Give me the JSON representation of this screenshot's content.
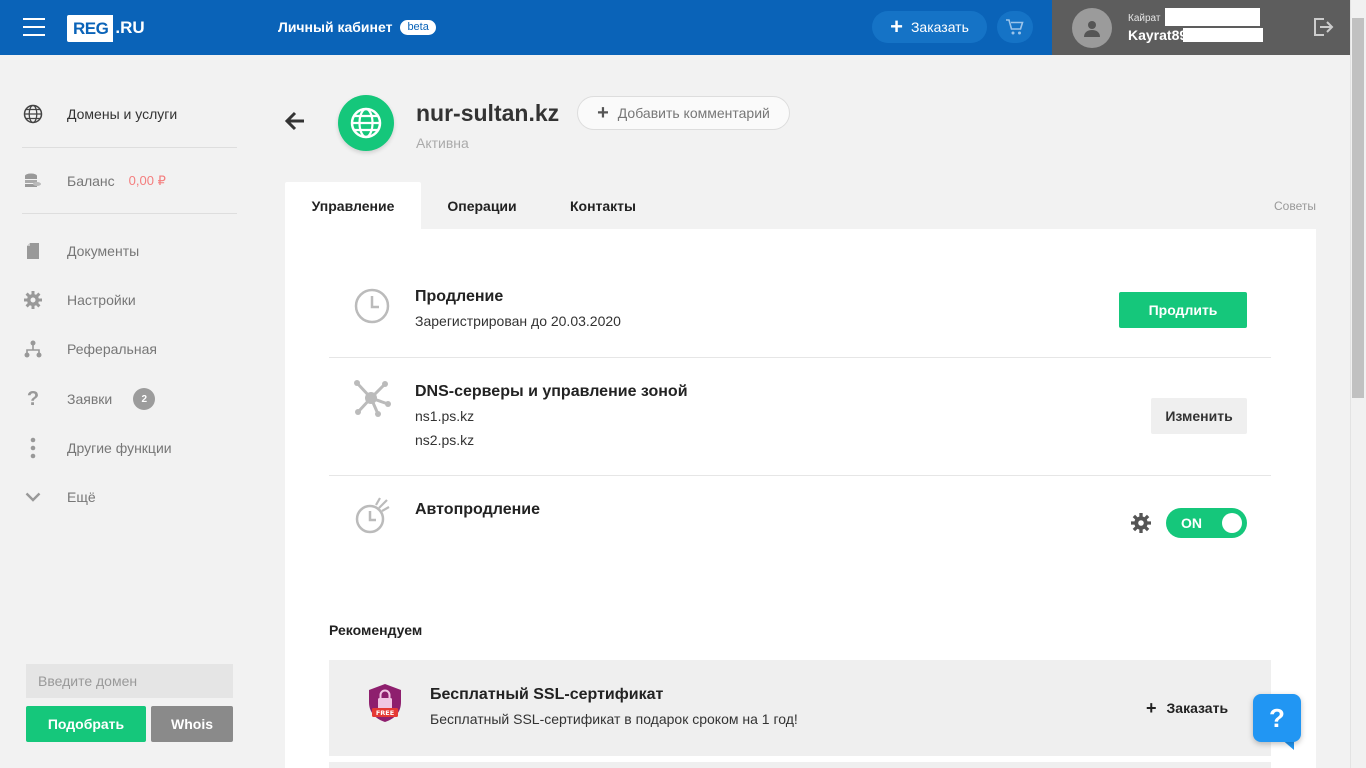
{
  "header": {
    "logo_reg": "REG",
    "logo_ru": ".RU",
    "cabinet_title": "Личный кабинет",
    "beta_badge": "beta",
    "order_label": "Заказать",
    "user_label": "Кайрат",
    "user_login": "Kayrat89"
  },
  "sidebar": {
    "items": [
      {
        "label": "Домены и услуги",
        "icon": "globe-icon"
      },
      {
        "label": "Баланс",
        "value": "0,00 ₽",
        "icon": "coins-icon"
      },
      {
        "label": "Документы",
        "icon": "document-icon"
      },
      {
        "label": "Настройки",
        "icon": "gear-icon"
      },
      {
        "label": "Реферальная",
        "icon": "referral-icon"
      },
      {
        "label": "Заявки",
        "badge": "2",
        "icon": "question-icon"
      },
      {
        "label": "Другие функции",
        "icon": "more-icon"
      },
      {
        "label": "Ещё",
        "icon": "chevron-down-icon"
      }
    ],
    "domain_placeholder": "Введите домен",
    "pick_label": "Подобрать",
    "whois_label": "Whois"
  },
  "domain": {
    "name": "nur-sultan.kz",
    "status": "Активна",
    "comment_label": "Добавить комментарий"
  },
  "tabs": [
    {
      "label": "Управление",
      "active": true
    },
    {
      "label": "Операции",
      "active": false
    },
    {
      "label": "Контакты",
      "active": false
    }
  ],
  "tips_label": "Советы",
  "rows": {
    "renewal": {
      "title": "Продление",
      "text": "Зарегистрирован до 20.03.2020",
      "button": "Продлить"
    },
    "dns": {
      "title": "DNS-серверы и управление зоной",
      "ns1": "ns1.ps.kz",
      "ns2": "ns2.ps.kz",
      "button": "Изменить"
    },
    "autorenew": {
      "title": "Автопродление",
      "toggle": "ON"
    }
  },
  "recommend": {
    "heading": "Рекомендуем",
    "title": "Бесплатный SSL-сертификат",
    "text": "Бесплатный SSL-сертификат в подарок сроком на 1 год!",
    "order_label": "Заказать",
    "badge_text": "FREE"
  },
  "help_label": "?",
  "colors": {
    "header_blue": "#0a63b8",
    "accent_green": "#15c77b",
    "user_bg": "#5d5d5d",
    "ssl_purple": "#8e1f6e"
  }
}
